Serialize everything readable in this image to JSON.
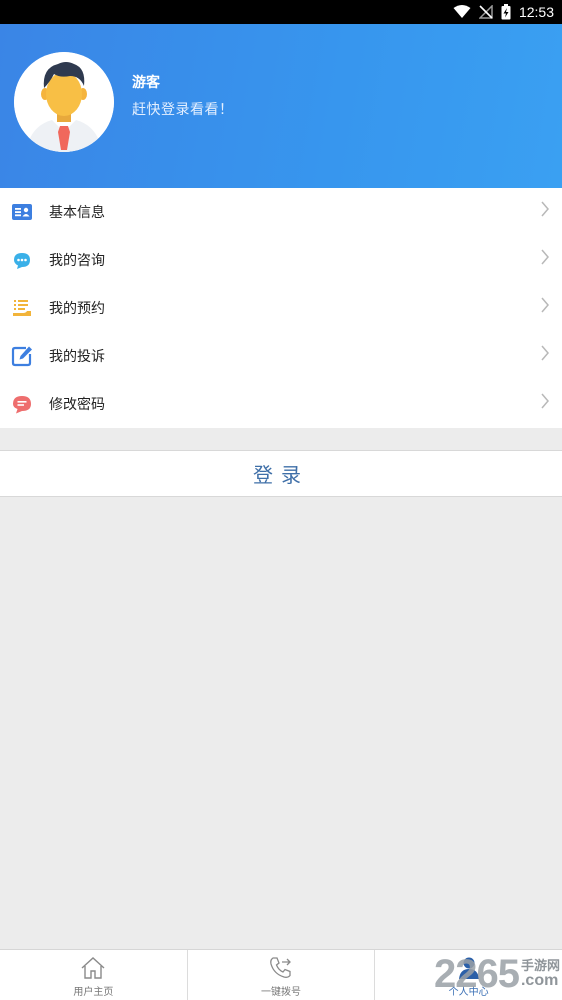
{
  "status_bar": {
    "time": "12:53",
    "icons": [
      "wifi-icon",
      "no-signal-icon",
      "battery-charging-icon"
    ]
  },
  "profile": {
    "name": "游客",
    "subtitle": "赶快登录看看！",
    "avatar_icon": "avatar-man-icon"
  },
  "menu": {
    "items": [
      {
        "label": "基本信息",
        "icon": "id-card-icon",
        "color": "#3d7fe0"
      },
      {
        "label": "我的咨询",
        "icon": "chat-bubbles-icon",
        "color": "#3ab0e8"
      },
      {
        "label": "我的预约",
        "icon": "list-hand-icon",
        "color": "#f2b43a"
      },
      {
        "label": "我的投诉",
        "icon": "edit-pen-icon",
        "color": "#3d7fe0"
      },
      {
        "label": "修改密码",
        "icon": "message-icon",
        "color": "#ee6e6e"
      }
    ]
  },
  "login": {
    "label": "登录"
  },
  "bottom_nav": {
    "tabs": [
      {
        "label": "用户主页",
        "icon": "home-icon"
      },
      {
        "label": "一键拨号",
        "icon": "phone-icon"
      },
      {
        "label": "个人中心",
        "icon": "person-icon",
        "active": true
      }
    ]
  },
  "watermark": {
    "number": "2265",
    "cn": "手游网",
    "com": ".com"
  },
  "colors": {
    "header_blue": "#3a8ce9",
    "accent": "#3f6fa8",
    "background": "#ececec"
  }
}
